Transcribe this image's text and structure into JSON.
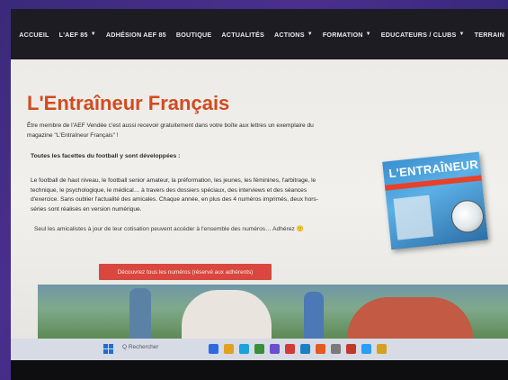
{
  "nav": {
    "items": [
      {
        "label": "ACCUEIL",
        "has_dropdown": false
      },
      {
        "label": "L'AEF 85",
        "has_dropdown": true
      },
      {
        "label": "ADHÉSION AEF 85",
        "has_dropdown": false
      },
      {
        "label": "BOUTIQUE",
        "has_dropdown": false
      },
      {
        "label": "ACTUALITÉS",
        "has_dropdown": false
      },
      {
        "label": "ACTIONS",
        "has_dropdown": true
      },
      {
        "label": "FORMATION",
        "has_dropdown": true
      },
      {
        "label": "EDUCATEURS / CLUBS",
        "has_dropdown": true
      },
      {
        "label": "TERRAIN",
        "has_dropdown": false
      }
    ]
  },
  "content": {
    "title": "L'Entraîneur Français",
    "intro_line1": "Être membre de l'AEF Vendée c'est aussi recevoir gratuitement dans votre boîte aux lettres un exemplaire du",
    "intro_line2": "magazine \"L'Entraîneur Français\" !",
    "facets_title": "Toutes les facettes du football y sont développées :",
    "facets_line1": "Le football de haut niveau, le football senior amateur, la préformation, les jeunes, les féminines, l'arbitrage, le",
    "facets_line2": "technique, le psychologique, le médical… à travers des dossiers spéciaux, des interviews et des séances",
    "facets_line3": "d'exercice. Sans oublier l'actualité des amicales. Chaque année, en plus des 4 numéros imprimés, deux hors-",
    "facets_line4": "séries sont réalisés en version numérique.",
    "members_text": "Seul les amicalistes à jour de leur cotisation peuvent accéder à l'ensemble des numéros… Adhérez 🙂",
    "cta_label": "Découvrez tous les numéros (réservé aux adhérents)",
    "magazine_cover_title": "L'ENTRAÎNEUR"
  },
  "taskbar": {
    "search_label": "Q Rechercher"
  },
  "colors": {
    "title": "#d24a1e",
    "cta_bg": "#d9473f",
    "nav_bg": "#1c1c22"
  }
}
